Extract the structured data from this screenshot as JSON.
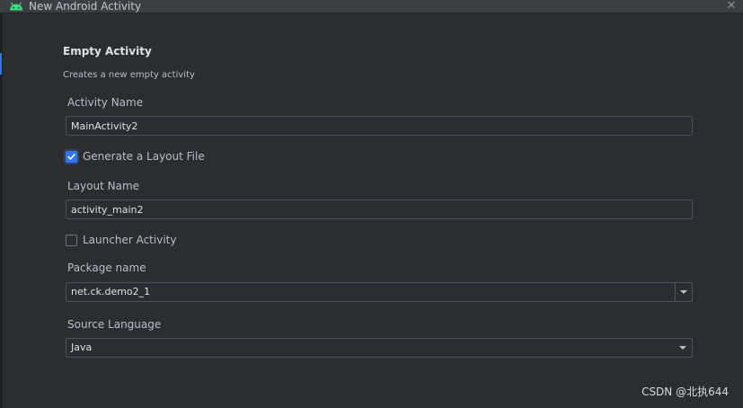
{
  "window": {
    "title": "New Android Activity",
    "close_glyph": "✕",
    "icons": {
      "app": "android-icon",
      "close": "close-icon"
    }
  },
  "template": {
    "heading": "Empty Activity",
    "description": "Creates a new empty activity"
  },
  "form": {
    "activity_name": {
      "label": "Activity Name",
      "value": "MainActivity2"
    },
    "generate_layout": {
      "label": "Generate a Layout File",
      "checked": true
    },
    "layout_name": {
      "label": "Layout Name",
      "value": "activity_main2"
    },
    "launcher_activity": {
      "label": "Launcher Activity",
      "checked": false
    },
    "package_name": {
      "label": "Package name",
      "value": "net.ck.demo2_1"
    },
    "source_language": {
      "label": "Source Language",
      "value": "Java"
    }
  },
  "watermark": "CSDN @北执644",
  "colors": {
    "accent": "#3574f0",
    "background": "#2b2d30",
    "border": "#4e5157",
    "android_green": "#3ddc84"
  }
}
